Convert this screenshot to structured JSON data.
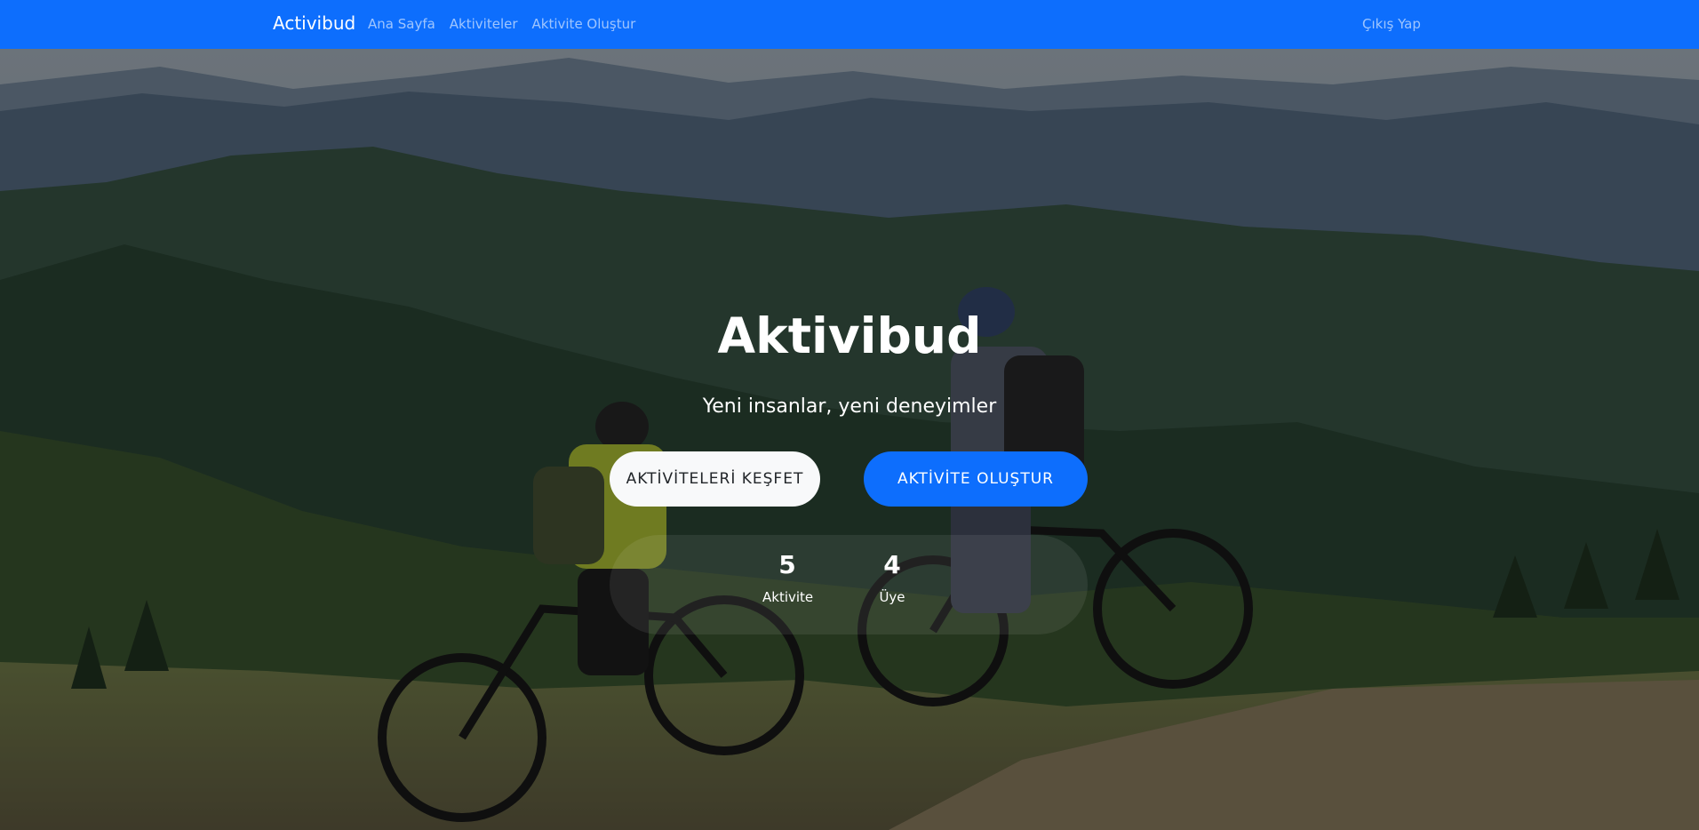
{
  "navbar": {
    "brand": "Activibud",
    "links": [
      "Ana Sayfa",
      "Aktiviteler",
      "Aktivite Oluştur"
    ],
    "logout": "Çıkış Yap",
    "bg_color": "#0d6efd"
  },
  "hero": {
    "title": "Aktivibud",
    "subtitle": "Yeni insanlar, yeni deneyimler",
    "buttons": {
      "explore": "AKTİVİTELERİ KEŞFET",
      "create": "AKTİVİTE OLUŞTUR"
    },
    "stats": [
      {
        "value": "5",
        "label": "Aktivite"
      },
      {
        "value": "4",
        "label": "Üye"
      }
    ]
  }
}
